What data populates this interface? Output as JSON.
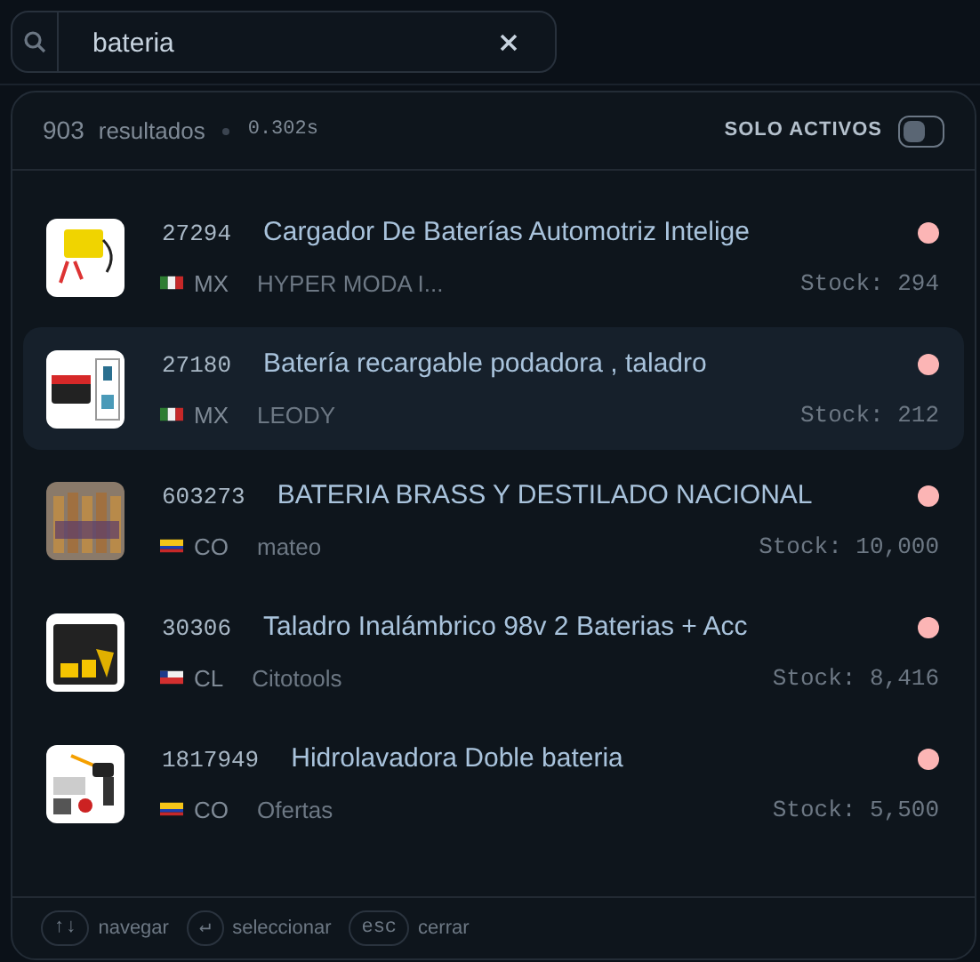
{
  "search": {
    "value": "bateria"
  },
  "summary": {
    "count": "903",
    "label": "resultados",
    "time": "0.302s"
  },
  "filter": {
    "label": "SOLO ACTIVOS",
    "on": false
  },
  "results": [
    {
      "id": "27294",
      "title": "Cargador De Baterías Automotriz Intelige",
      "country": "MX",
      "seller": "HYPER MODA I...",
      "stock": "Stock: 294",
      "color": "#fcb5b5",
      "selected": false
    },
    {
      "id": "27180",
      "title": "Batería recargable podadora , taladro",
      "country": "MX",
      "seller": "LEODY",
      "stock": "Stock: 212",
      "color": "#fcb5b5",
      "selected": true
    },
    {
      "id": "603273",
      "title": "BATERIA BRASS Y DESTILADO NACIONAL",
      "country": "CO",
      "seller": "mateo",
      "stock": "Stock: 10,000",
      "color": "#fcb5b5",
      "selected": false
    },
    {
      "id": "30306",
      "title": "Taladro Inalámbrico 98v 2 Baterias + Acc",
      "country": "CL",
      "seller": "Citotools",
      "stock": "Stock: 8,416",
      "color": "#fcb5b5",
      "selected": false
    },
    {
      "id": "1817949",
      "title": "Hidrolavadora Doble bateria",
      "country": "CO",
      "seller": "Ofertas",
      "stock": "Stock: 5,500",
      "color": "#fcb5b5",
      "selected": false
    }
  ],
  "shortcuts": [
    {
      "key": "↑↓",
      "label": "navegar"
    },
    {
      "key": "↵",
      "label": "seleccionar"
    },
    {
      "key": "esc",
      "label": "cerrar"
    }
  ]
}
